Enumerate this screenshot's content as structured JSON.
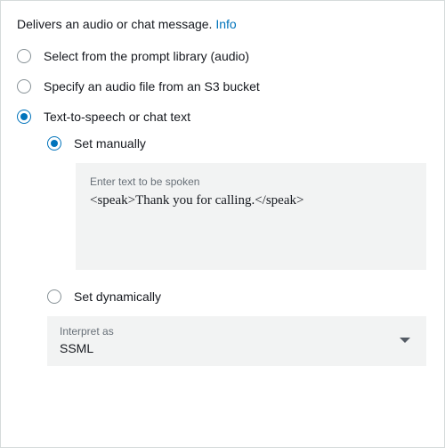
{
  "header": {
    "text": "Delivers an audio or chat message. ",
    "info_label": "Info"
  },
  "options": {
    "prompt_library": "Select from the prompt library (audio)",
    "s3_audio": "Specify an audio file from an S3 bucket",
    "tts": "Text-to-speech or chat text"
  },
  "tts": {
    "set_manually": "Set manually",
    "set_dynamically": "Set dynamically",
    "textarea_label": "Enter text to be spoken",
    "textarea_value": "<speak>Thank you for calling.</speak>",
    "interpret_label": "Interpret as",
    "interpret_value": "SSML"
  }
}
